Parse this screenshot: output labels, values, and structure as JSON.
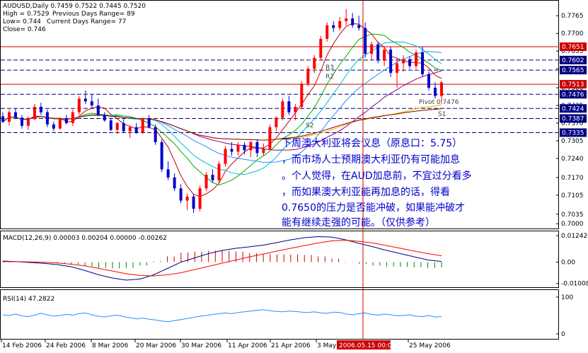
{
  "window": {
    "symbol_info": "AUDUSD,Daily  0.7459 0.7522 0.7445 0.7520",
    "high_text": "High = 0.7529",
    "prev_range_text": "Previous Days Range= 89",
    "low_text": "Low= 0.744",
    "curr_range_text": "Current Days Range= 77",
    "close_text": "Close= 0.746"
  },
  "colors": {
    "background": "#ffffff",
    "axis": "#000000",
    "bull": "#ff0000",
    "bear": "#0000cc",
    "hline": "#cc0000",
    "dotted_line": "#000080",
    "price_badge_red": "#cc0000",
    "price_badge_navy": "#000080",
    "annotation": "#0000cc",
    "macd_line": "#000080",
    "signal_line": "#ff0000",
    "histogram_pos": "#cc0000",
    "histogram_neg": "#008000",
    "rsi_line": "#1e90ff",
    "vertical_marker": "#cc0000"
  },
  "annotation": {
    "lines": [
      "下周澳大利亚将会议息（原息口：5.75）",
      "，而市场人士预期澳大利亚仍有可能加息",
      "。个人觉得，在AUD加息前，不宜过分看多",
      "，而如果澳大利亚能再加息的话，得看",
      "0.7650的压力是否能冲破，如果能冲破才",
      "能有继续走强的可能。（仅供参考）"
    ]
  },
  "level_labels": {
    "r3": "R3",
    "r2": "R2",
    "s1": "S1",
    "s2": "S2",
    "pivot": "Pivot 0.7476"
  },
  "chart_data": [
    {
      "type": "candlestick",
      "title": "AUDUSD,Daily",
      "ylim": [
        0.6985,
        0.7815
      ],
      "y_ticks": [
        "0.7765",
        "0.7700",
        "0.7635",
        "0.7570",
        "0.7500",
        "0.7435",
        "0.7370",
        "0.7305",
        "0.7240",
        "0.7170",
        "0.7105",
        "0.7035",
        "0.7000"
      ],
      "highlighted_levels": [
        {
          "value": 0.7651,
          "label": "0.7651",
          "style": "solid-red"
        },
        {
          "value": 0.7602,
          "label": "0.7602",
          "style": "dotted"
        },
        {
          "value": 0.7565,
          "label": "0.7565",
          "style": "dotted"
        },
        {
          "value": 0.7513,
          "label": "0.7513",
          "style": "solid-red"
        },
        {
          "value": 0.7476,
          "label": "0.7476",
          "style": "dotted"
        },
        {
          "value": 0.7424,
          "label": "0.7424",
          "style": "dotted"
        },
        {
          "value": 0.7387,
          "label": "0.7387",
          "style": "dotted"
        },
        {
          "value": 0.7335,
          "label": "0.7335",
          "style": "dotted"
        }
      ],
      "candles": [
        [
          0.7395,
          0.741,
          0.737,
          0.7375
        ],
        [
          0.7375,
          0.742,
          0.736,
          0.741
        ],
        [
          0.741,
          0.7425,
          0.7385,
          0.739
        ],
        [
          0.739,
          0.74,
          0.735,
          0.736
        ],
        [
          0.736,
          0.7395,
          0.7345,
          0.7385
        ],
        [
          0.7385,
          0.744,
          0.738,
          0.743
        ],
        [
          0.743,
          0.7445,
          0.74,
          0.741
        ],
        [
          0.741,
          0.742,
          0.7355,
          0.7365
        ],
        [
          0.7365,
          0.7375,
          0.734,
          0.735
        ],
        [
          0.735,
          0.739,
          0.7345,
          0.7385
        ],
        [
          0.7385,
          0.74,
          0.7365,
          0.737
        ],
        [
          0.737,
          0.742,
          0.736,
          0.741
        ],
        [
          0.741,
          0.747,
          0.74,
          0.746
        ],
        [
          0.746,
          0.749,
          0.744,
          0.745
        ],
        [
          0.745,
          0.7475,
          0.7425,
          0.7435
        ],
        [
          0.7435,
          0.746,
          0.7395,
          0.74
        ],
        [
          0.74,
          0.741,
          0.7375,
          0.738
        ],
        [
          0.738,
          0.739,
          0.734,
          0.7345
        ],
        [
          0.7345,
          0.7375,
          0.733,
          0.737
        ],
        [
          0.737,
          0.7385,
          0.7335,
          0.734
        ],
        [
          0.734,
          0.736,
          0.7315,
          0.7355
        ],
        [
          0.7355,
          0.737,
          0.733,
          0.7335
        ],
        [
          0.7335,
          0.739,
          0.733,
          0.7385
        ],
        [
          0.7385,
          0.74,
          0.735,
          0.7355
        ],
        [
          0.7355,
          0.7365,
          0.729,
          0.73
        ],
        [
          0.73,
          0.731,
          0.719,
          0.72
        ],
        [
          0.72,
          0.723,
          0.716,
          0.717
        ],
        [
          0.717,
          0.7185,
          0.712,
          0.713
        ],
        [
          0.713,
          0.7145,
          0.7075,
          0.7085
        ],
        [
          0.7085,
          0.711,
          0.705,
          0.71
        ],
        [
          0.71,
          0.711,
          0.704,
          0.7055
        ],
        [
          0.7055,
          0.714,
          0.7045,
          0.713
        ],
        [
          0.713,
          0.719,
          0.712,
          0.718
        ],
        [
          0.718,
          0.72,
          0.715,
          0.716
        ],
        [
          0.716,
          0.723,
          0.715,
          0.722
        ],
        [
          0.722,
          0.7285,
          0.721,
          0.7275
        ],
        [
          0.7275,
          0.73,
          0.725,
          0.7265
        ],
        [
          0.7265,
          0.73,
          0.725,
          0.729
        ],
        [
          0.729,
          0.73,
          0.7255,
          0.727
        ],
        [
          0.727,
          0.7305,
          0.7245,
          0.73
        ],
        [
          0.73,
          0.731,
          0.7245,
          0.726
        ],
        [
          0.726,
          0.7295,
          0.725,
          0.7275
        ],
        [
          0.7275,
          0.7365,
          0.727,
          0.7355
        ],
        [
          0.7355,
          0.7395,
          0.734,
          0.739
        ],
        [
          0.739,
          0.746,
          0.738,
          0.745
        ],
        [
          0.745,
          0.747,
          0.74,
          0.741
        ],
        [
          0.741,
          0.744,
          0.738,
          0.743
        ],
        [
          0.743,
          0.7525,
          0.742,
          0.7515
        ],
        [
          0.7515,
          0.758,
          0.7505,
          0.757
        ],
        [
          0.757,
          0.762,
          0.7555,
          0.761
        ],
        [
          0.761,
          0.769,
          0.76,
          0.768
        ],
        [
          0.768,
          0.774,
          0.767,
          0.773
        ],
        [
          0.773,
          0.7745,
          0.7705,
          0.772
        ],
        [
          0.772,
          0.776,
          0.771,
          0.7745
        ],
        [
          0.7745,
          0.779,
          0.773,
          0.7755
        ],
        [
          0.7755,
          0.7775,
          0.772,
          0.773
        ],
        [
          0.773,
          0.7765,
          0.771,
          0.772
        ],
        [
          0.772,
          0.774,
          0.761,
          0.7625
        ],
        [
          0.7625,
          0.767,
          0.76,
          0.766
        ],
        [
          0.766,
          0.767,
          0.759,
          0.76
        ],
        [
          0.76,
          0.765,
          0.758,
          0.764
        ],
        [
          0.764,
          0.765,
          0.754,
          0.7555
        ],
        [
          0.7555,
          0.761,
          0.75,
          0.759
        ],
        [
          0.759,
          0.762,
          0.756,
          0.7605
        ],
        [
          0.7605,
          0.7615,
          0.757,
          0.758
        ],
        [
          0.758,
          0.764,
          0.757,
          0.763
        ],
        [
          0.763,
          0.765,
          0.754,
          0.755
        ],
        [
          0.755,
          0.756,
          0.749,
          0.75
        ],
        [
          0.75,
          0.752,
          0.746,
          0.747
        ],
        [
          0.747,
          0.7525,
          0.7445,
          0.752
        ]
      ]
    },
    {
      "type": "line",
      "title": "MACD(12,26,9) 0.00003 0.00204 0.00000 -0.00262",
      "ylim": [
        -0.0115,
        0.0135
      ],
      "y_ticks": [
        "0.01242",
        "0.00",
        "-0.01008"
      ],
      "series": [
        {
          "values": [
            0.0005,
            0.0002,
            -0.0002,
            -0.0006,
            -0.0012,
            -0.0022,
            -0.004,
            -0.006,
            -0.0075,
            -0.0085,
            -0.008,
            -0.006,
            -0.003,
            0.0,
            0.002,
            0.004,
            0.0055,
            0.0065,
            0.0072,
            0.008,
            0.0092,
            0.0105,
            0.0115,
            0.012,
            0.0118,
            0.0105,
            0.0088,
            0.0072,
            0.0055,
            0.004,
            0.0025,
            0.001,
            0.0003
          ]
        },
        {
          "values": [
            0.0002,
            0.0002,
            0.0001,
            -0.0001,
            -0.0004,
            -0.001,
            -0.0018,
            -0.003,
            -0.0042,
            -0.0055,
            -0.0063,
            -0.0065,
            -0.006,
            -0.005,
            -0.0035,
            -0.002,
            -0.0005,
            0.001,
            0.0025,
            0.0038,
            0.0052,
            0.0065,
            0.0078,
            0.009,
            0.01,
            0.0103,
            0.0098,
            0.009,
            0.0078,
            0.0065,
            0.0052,
            0.004,
            0.003
          ]
        }
      ]
    },
    {
      "type": "line",
      "title": "RSI(14) 47.2822",
      "ylim": [
        0,
        100
      ],
      "y_ticks": [
        "100",
        "0"
      ],
      "series": [
        {
          "values": [
            52,
            50,
            54,
            49,
            47,
            51,
            56,
            52,
            48,
            50,
            53,
            51,
            55,
            57,
            52,
            48,
            46,
            49,
            51,
            47,
            44,
            41,
            43,
            40,
            38,
            35,
            33,
            36,
            39,
            42,
            45,
            48,
            50,
            53,
            55,
            57,
            55,
            58,
            60,
            62,
            64,
            66,
            63,
            61,
            60,
            62,
            61,
            59,
            58,
            60,
            57,
            56,
            59,
            58,
            54,
            52,
            55,
            57,
            53,
            51,
            54,
            52,
            49,
            50,
            52,
            48,
            47,
            50,
            46,
            47
          ]
        }
      ]
    }
  ],
  "x_axis": {
    "labels": [
      "14 Feb 2006",
      "24 Feb 2006",
      "8 Mar 2006",
      "20 Mar 2006",
      "30 Mar 2006",
      "11 Apr 2006",
      "21 Apr 2006",
      "3 May 2006",
      "25 May 2006"
    ],
    "cursor_label": "2006.05.15 00:00"
  }
}
